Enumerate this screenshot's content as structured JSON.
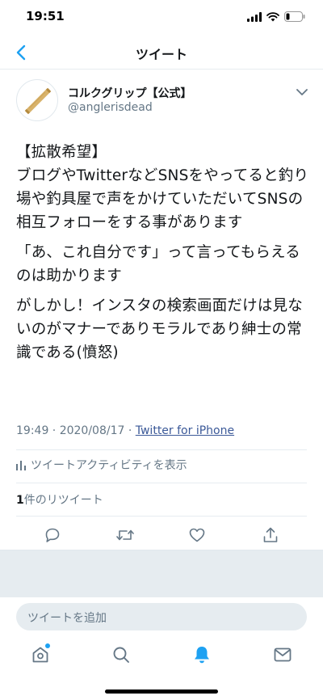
{
  "status_bar": {
    "time": "19:51"
  },
  "nav": {
    "title": "ツイート"
  },
  "tweet": {
    "author_name": "コルクグリップ【公式】",
    "author_handle": "@anglerisdead",
    "paragraphs": [
      "【拡散希望】\nブログやTwitterなどSNSをやってると釣り場や釣具屋で声をかけていただいてSNSの相互フォローをする事があります",
      "「あ、これ自分です」って言ってもらえるのは助かります",
      "がしかし！インスタの検索画面だけは見ないのがマナーでありモラルであり紳士の常識である(憤怒)"
    ],
    "timestamp": "19:49 · 2020/08/17 · ",
    "source": "Twitter for iPhone",
    "activity_label": "ツイートアクティビティを表示",
    "retweet_count": "1",
    "retweet_label": "件のリツイート"
  },
  "reply": {
    "placeholder": "ツイートを追加"
  },
  "colors": {
    "accent": "#1da1f2",
    "muted": "#657786",
    "divider": "#e6ecf0"
  }
}
